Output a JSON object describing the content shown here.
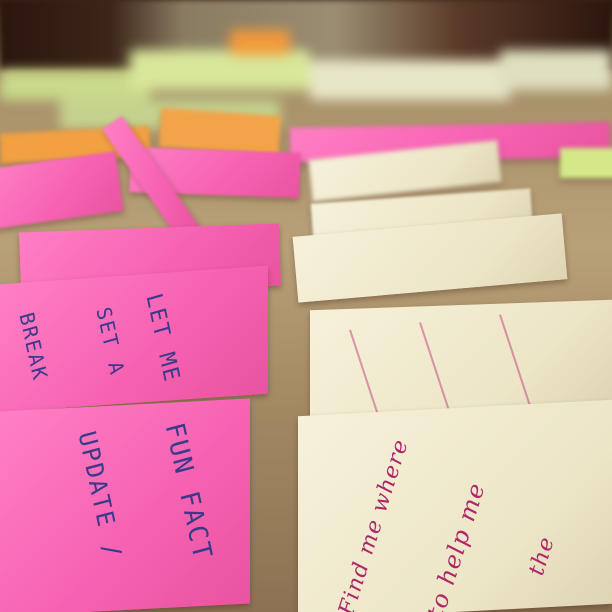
{
  "photo": {
    "subject": "sticky-notes-on-table",
    "colors": {
      "pink_note": "#f661b2",
      "cream_note": "#ece5c6",
      "table": "#b8a078",
      "marker_blue": "#3a3a8a",
      "marker_magenta": "#b0266a"
    },
    "notes": {
      "n1_line1": "LET ME",
      "n1_line2": "SET A",
      "n1_line3": "BREAK",
      "n2_line1": "FUN FACT",
      "n2_line2": "UPDATE /",
      "n3_line1": "Find me where",
      "n3_line2": "to help me",
      "n3_line3": "the"
    }
  }
}
